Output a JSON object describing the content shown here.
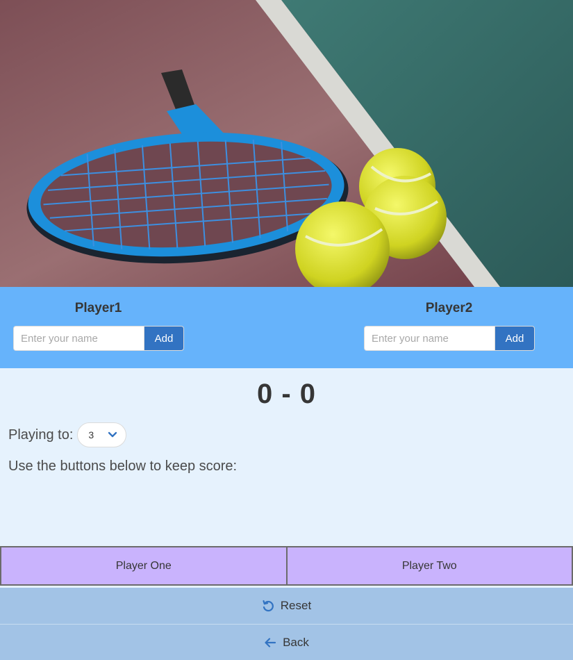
{
  "hero": {
    "image": "tennis-racket-and-balls-photo"
  },
  "players": [
    {
      "name": "Player1",
      "input_placeholder": "Enter your name",
      "add_label": "Add"
    },
    {
      "name": "Player2",
      "input_placeholder": "Enter your name",
      "add_label": "Add"
    }
  ],
  "score": {
    "display": "0 - 0"
  },
  "settings": {
    "playing_to_label": "Playing to:",
    "playing_to_value": "3"
  },
  "instructions": "Use the buttons below to keep score:",
  "buttons": {
    "player_one": "Player One",
    "player_two": "Player Two",
    "reset": "Reset",
    "back": "Back"
  },
  "colors": {
    "players_band": "#66b3fb",
    "add_button": "#3273c2",
    "score_button": "#c9b3fd",
    "action_button": "#a2c3e6",
    "page_bg": "#e6f2fd"
  }
}
